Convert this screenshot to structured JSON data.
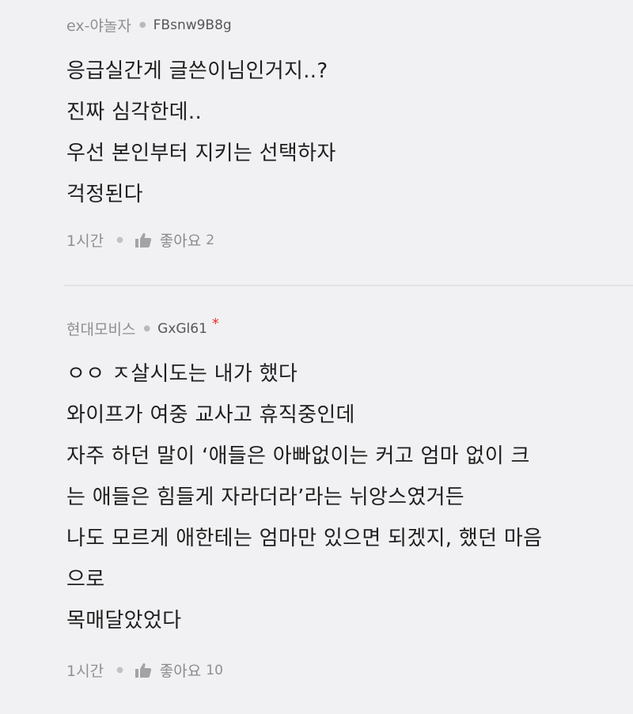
{
  "comments": [
    {
      "author": "ex-야놀자",
      "user_id": "FBsnw9B8g",
      "lines": [
        "응급실간게 글쓴이님인거지..?",
        "진짜 심각한데..",
        "우선 본인부터 지키는 선택하자",
        "걱정된다"
      ],
      "time": "1시간",
      "like_label": "좋아요",
      "like_count": "2"
    },
    {
      "author": "현대모비스",
      "user_id": "GxGl61",
      "badge": "*",
      "lines": [
        "ㅇㅇ ㅈ살시도는 내가 했다",
        "와이프가 여중 교사고 휴직중인데",
        "자주 하던 말이 ‘애들은 아빠없이는 커고 엄마 없이 크",
        "는 애들은 힘들게 자라더라’라는 뉘앙스였거든",
        "나도 모르게 애한테는 엄마만 있으면 되겠지, 했던 마음",
        "으로",
        "목매달았었다"
      ],
      "time": "1시간",
      "like_label": "좋아요",
      "like_count": "10"
    }
  ],
  "colors": {
    "background": "#f1f1f3",
    "text": "#1f1f1f",
    "muted": "#8f8f93",
    "badge": "#e2332d"
  },
  "icons": {
    "like": "thumbs-up-icon"
  }
}
